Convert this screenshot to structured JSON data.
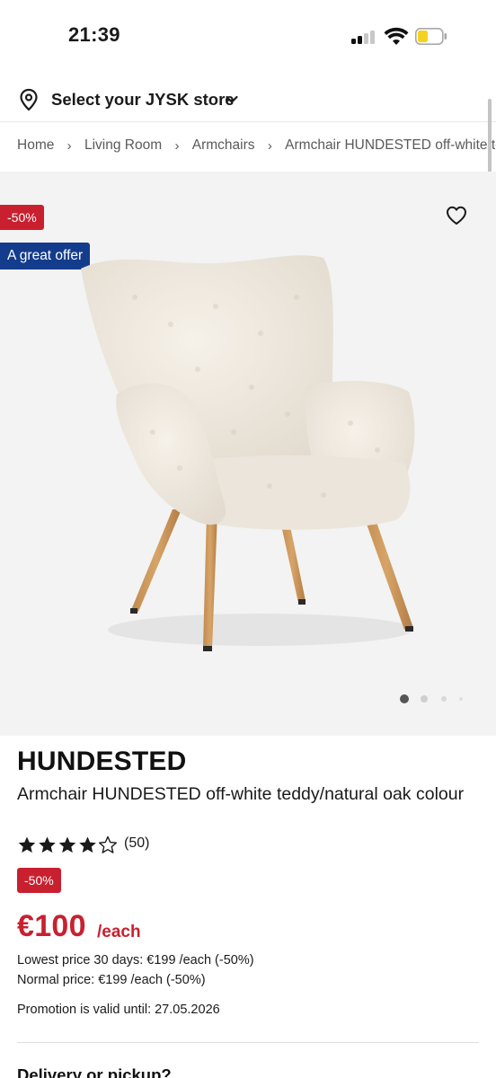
{
  "status_bar": {
    "time": "21:39",
    "icons": [
      "cellular-signal-icon",
      "wifi-icon",
      "battery-icon"
    ],
    "battery_color": "#f4d21f"
  },
  "store_selector": {
    "label": "Select your JYSK store",
    "icon": "location-pin-icon"
  },
  "breadcrumb": [
    "Home",
    "Living Room",
    "Armchairs",
    "Armchair HUNDESTED off-white teddy/natural oak colour"
  ],
  "image": {
    "discount_badge": "-50%",
    "offer_badge": "A great offer",
    "carousel_total_dots": 4,
    "carousel_active_index": 0
  },
  "product": {
    "brand": "HUNDESTED",
    "name": "Armchair HUNDESTED off-white teddy/natural oak colour",
    "rating": 4,
    "rating_max": 5,
    "review_count": "(50)",
    "discount_badge": "-50%",
    "price": "€100",
    "price_unit": "/each",
    "lowest_price": "Lowest price 30 days: €199 /each (-50%)",
    "normal_price": "Normal price: €199 /each (-50%)",
    "promotion": "Promotion is valid until: 27.05.2026"
  },
  "delivery": {
    "heading": "Delivery or pickup?"
  },
  "colors": {
    "sale_red": "#c8202f",
    "offer_blue": "#143c8c"
  }
}
